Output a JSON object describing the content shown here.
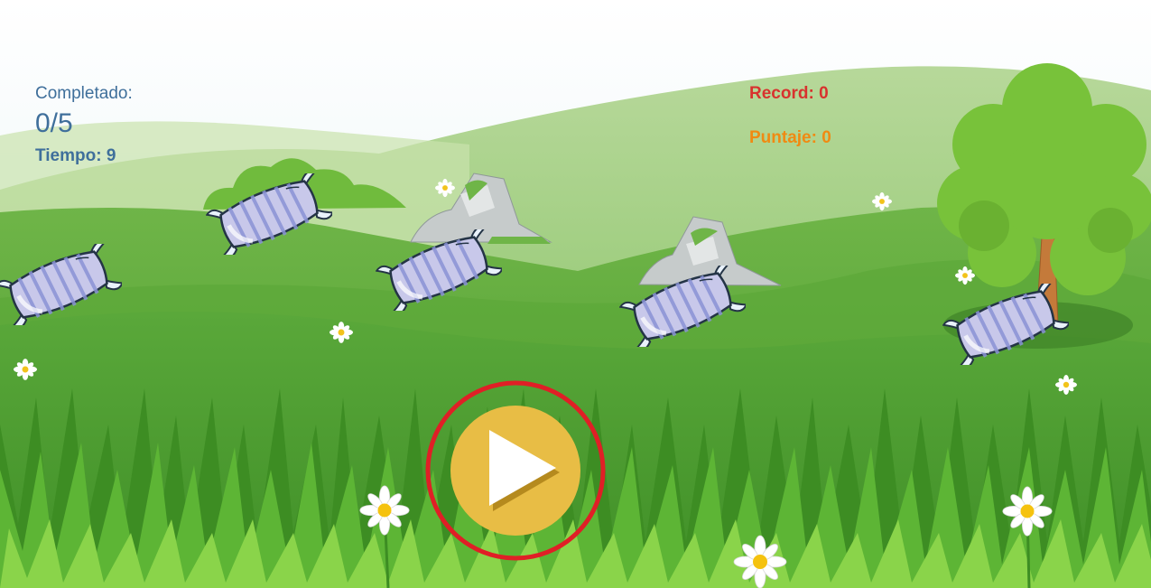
{
  "hud": {
    "completed_label": "Completado:",
    "progress": "0/5",
    "time": "Tiempo: 9",
    "record": "Record: 0",
    "score": "Puntaje: 0"
  },
  "colors": {
    "hud_text": "#3f6f9b",
    "record": "#d8322e",
    "score": "#f08a12",
    "play_button": "#e8bd45",
    "play_ring": "#e01f26"
  },
  "targets": {
    "count": 5,
    "icon": "pillow-icon"
  },
  "controls": {
    "play_icon": "play-icon"
  }
}
